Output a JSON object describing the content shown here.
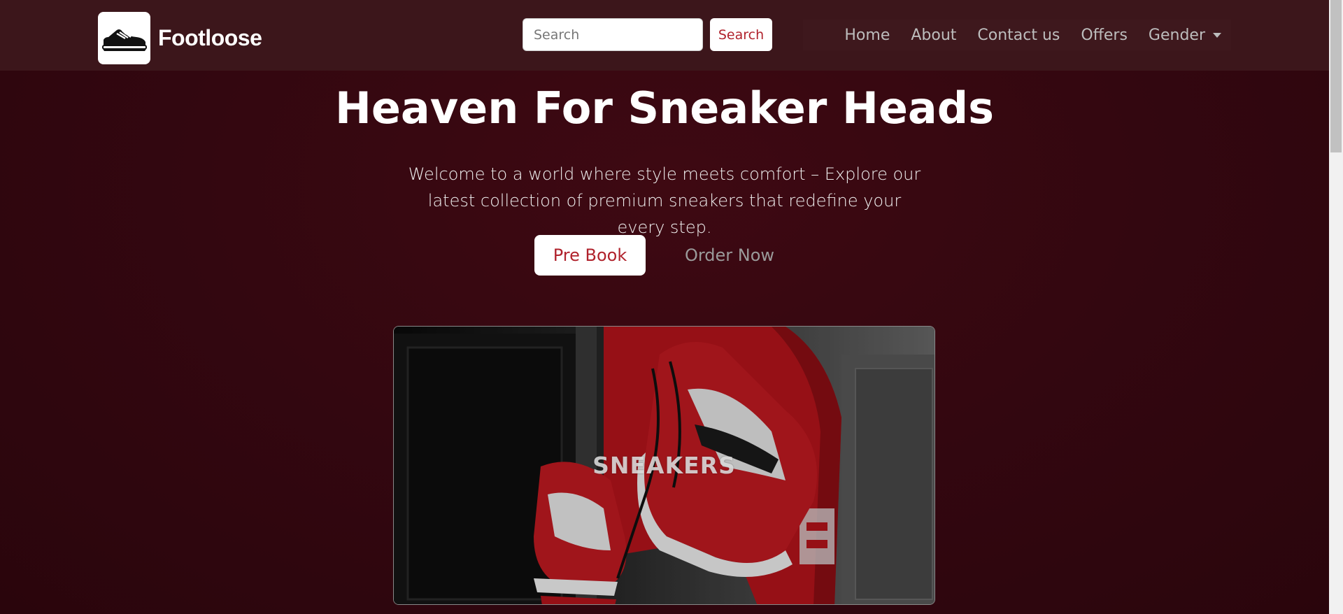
{
  "header": {
    "brand_name": "Footloose",
    "logo_icon": "sneaker-icon",
    "search": {
      "placeholder": "Search",
      "value": "",
      "button_label": "Search"
    },
    "nav": [
      {
        "label": "Home"
      },
      {
        "label": "About"
      },
      {
        "label": "Contact us"
      },
      {
        "label": "Offers"
      },
      {
        "label": "Gender",
        "dropdown": true
      }
    ]
  },
  "hero": {
    "title": "Heaven For Sneaker Heads",
    "subtitle": "Welcome to a world where style meets comfort – Explore our latest collection of premium sneakers that redefine your every step.",
    "primary_button": "Pre Book",
    "secondary_button": "Order Now",
    "image_overlay_text": "SNEAKERS"
  },
  "colors": {
    "page_background": "#330710",
    "navbar_background": "#3c161b",
    "accent": "#b0222c",
    "nav_text": "#bdbdbd"
  }
}
